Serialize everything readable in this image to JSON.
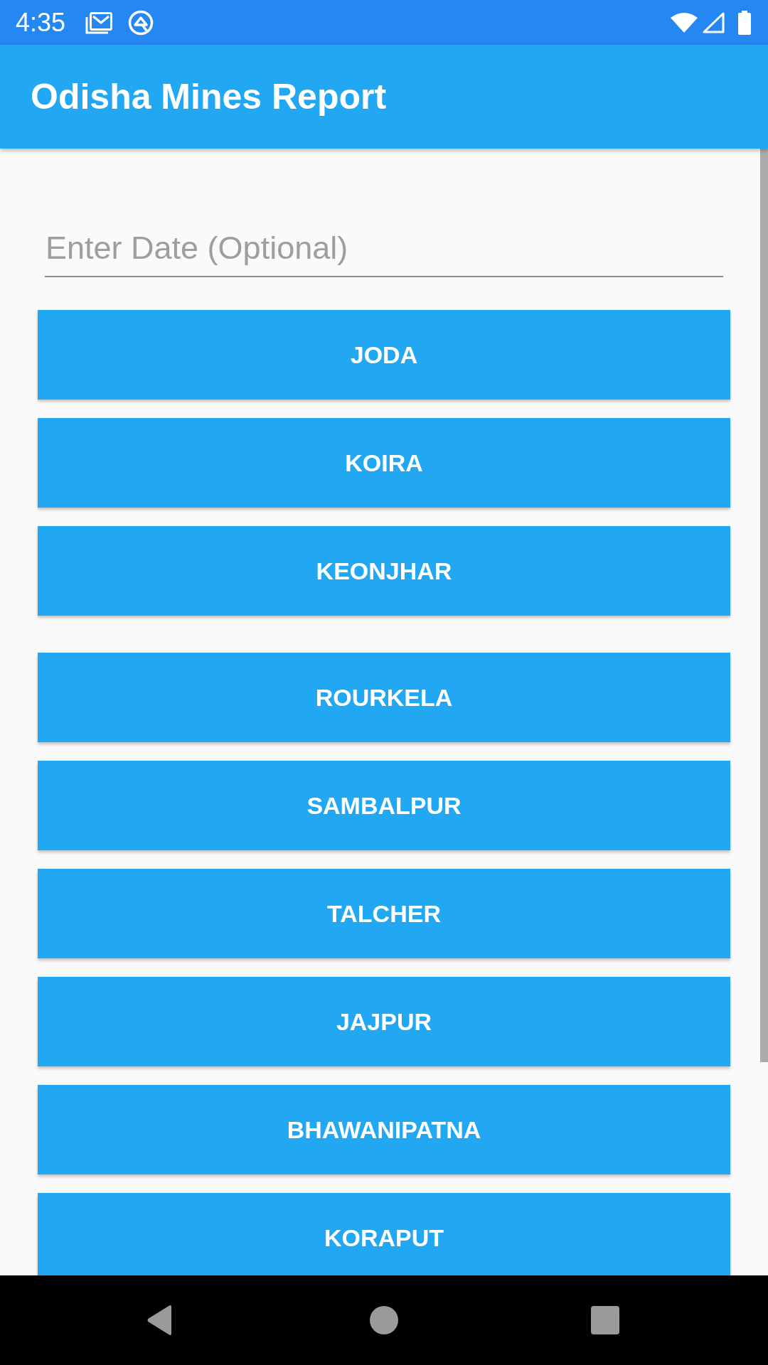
{
  "status_bar": {
    "time": "4:35"
  },
  "app_bar": {
    "title": "Odisha Mines Report"
  },
  "date_field": {
    "placeholder": "Enter Date (Optional)"
  },
  "buttons": [
    {
      "label": "JODA"
    },
    {
      "label": "KOIRA"
    },
    {
      "label": "KEONJHAR"
    },
    {
      "label": "ROURKELA"
    },
    {
      "label": "SAMBALPUR"
    },
    {
      "label": "TALCHER"
    },
    {
      "label": "JAJPUR"
    },
    {
      "label": "BHAWANIPATNA"
    },
    {
      "label": "KORAPUT"
    }
  ]
}
